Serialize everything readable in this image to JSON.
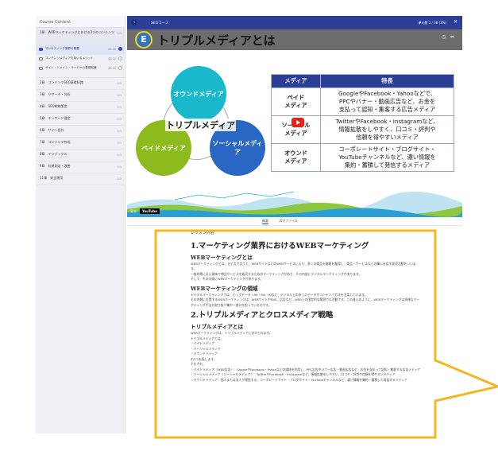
{
  "sidebar": {
    "title": "Course Content",
    "open_chapter": {
      "label": "1章　WEBマーケティングにおける3つのコンテンツ",
      "meta": "2/3"
    },
    "lessons": [
      {
        "label": "マーケティング業界の概要",
        "duration": "05:36",
        "active": true
      },
      {
        "label": "コンテンツメディアを用いるメリット",
        "duration": "00:00",
        "active": false
      },
      {
        "label": "サイト・ドメイン・サーバーの基礎知識",
        "duration": "00:00",
        "active": false
      }
    ],
    "chapters": [
      {
        "label": "2章　コンテンツSEO基礎知識",
        "meta": "0/3"
      },
      {
        "label": "3章　リサーチ・分析",
        "meta": "0/3"
      },
      {
        "label": "4章　SEO戦略策定",
        "meta": "0/3"
      },
      {
        "label": "5章　キーワード選定",
        "meta": "0/3"
      },
      {
        "label": "6章　サイト設計",
        "meta": "0/3"
      },
      {
        "label": "7章　コンテンツ作成",
        "meta": "0/3"
      },
      {
        "label": "8章　インデックス",
        "meta": "0/3"
      },
      {
        "label": "9章　効果測定・改善",
        "meta": "0/3"
      },
      {
        "label": "11章　安全運用",
        "meta": "0/3"
      }
    ]
  },
  "header": {
    "back_icon": "chevron-left",
    "title": "SEOコース",
    "counter": "単元数 1 / 38 (3%)",
    "close_icon": "close"
  },
  "video": {
    "logo_text": "E",
    "slide_title": "トリプルメディアとは",
    "circles": {
      "owned": "オウンドメディア",
      "paid": "ペイドメディア",
      "social": "ソーシャルメディア",
      "center": "トリプルメディア"
    },
    "table": {
      "headers": [
        "メディア",
        "特長"
      ],
      "rows": [
        {
          "media": "ペイド\nメディア",
          "feature": "GoogleやFacebook・Yahooなどで、\nPPCやバナー・動画広告など、お金を\n支払って認知・集客する広告メディア"
        },
        {
          "media": "ソーシャル\nメディア",
          "feature": "TwitterやFacebook・Instagramなど、\n情報拡散をしやすく、口コミ・評判や\n信頼を得やすいメディア"
        },
        {
          "media": "オウンド\nメディア",
          "feature": "コーポレートサイト・ブログサイト・\nYouTubeチャンネルなど、濃い情報を\n集約・蓄積して発信するメディア"
        }
      ]
    },
    "controls": {
      "watch_on": "見る",
      "youtube": "YouTube"
    }
  },
  "tabs": [
    {
      "label": "概要",
      "active": true
    },
    {
      "label": "添付ファイル",
      "active": false
    }
  ],
  "content": {
    "label": "レッスン内容",
    "h1_1": "1.マーケティング業界におけるWEBマーケティング",
    "h2_1": "WEBマーケティングとは",
    "p1": "WEBマーケティングとは、ひと言で言うと、WEBサイトなどのWEBサービスにより、多くの商品を顧客を獲得し、商品・サービスなどの購入を促す販売活動をいいます。",
    "p2": "一般的等に近い意味で商品サービスを販売するためのマーケティングがあり、その内部にデジタルマーケティングがあります。",
    "p3": "そして、その内側にWEBマーケティングがあります。",
    "h2_2": "WEBマーケティングの領域",
    "p4": "デジタルマーケティングでは、ビッグデータ・AR・MA・AIなど、デジタル上の多くのデータやコンテンツ方法を活用しています。",
    "p5": "その内側に位置するWEBマーケティングは、WEBサイトやSNS、広告など、WEB上の限定的な範囲での活動です。この違いのように、WEBマーケティングは多様なマーケティング手法を取り扱う集中一部分を担っているのです。",
    "h1_2": "2.トリプルメディアとクロスメディア戦略",
    "h2_3": "トリプルメディアとは",
    "p6": "WEBマーケティングは、トリプルメディアに分けられます。",
    "p7": "トリプルメディアとは、",
    "p8": "・ペイドメディア",
    "p9": "・ソーシャルメディア",
    "p10": "・オウンドメディア",
    "p11": "の3つを指します。",
    "p12": "それぞれ、",
    "p13": "・ペイドメディア（WEB広告）：GoogleやFacebook・Yahooなどの媒体を利用し、PPC広告やバナー広告・動画広告など、お金を支払って認知・集客する広告メディア",
    "p14": "・ソーシャルメディア（ソーシャルメディア）：TwitterやFacebook・Instagramなど、情報拡散をしやすい、口コミ・評判や信頼を得やすいメディア",
    "p15": "・オウンドメディア：個人または法人が運営する、コーポレートサイト・ブログサイト・YouTubeチャンネルなど、濃い情報を集約・蓄積して発信するメディア"
  },
  "colors": {
    "header_blue": "#2b3f97",
    "callout_border": "#f2b824",
    "owned": "#1ab8cc",
    "paid": "#8dbb1d",
    "social": "#2a66c4"
  }
}
